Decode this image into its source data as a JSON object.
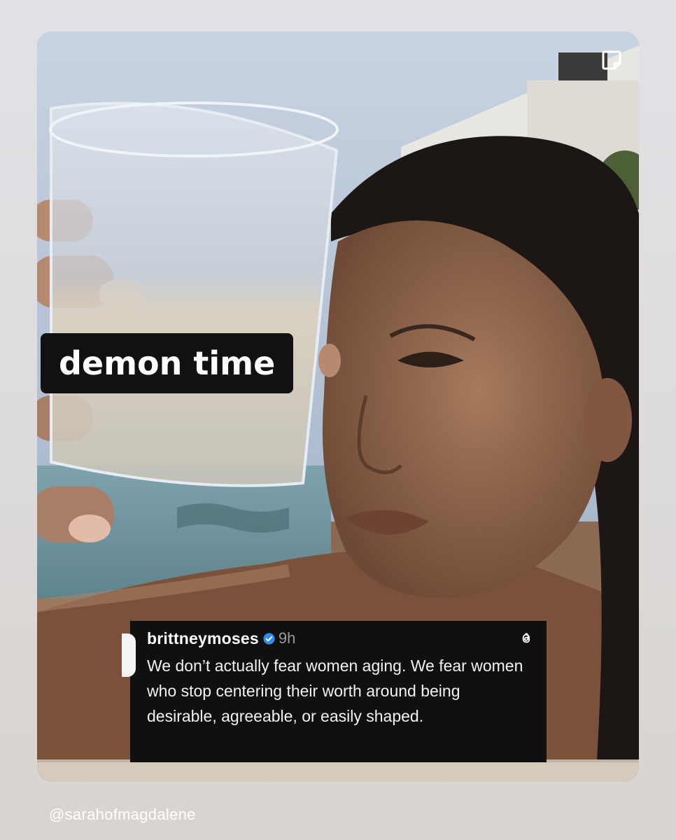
{
  "story": {
    "caption": "demon time",
    "image_subject": "woman-in-pool-holding-glass-selfie"
  },
  "post": {
    "username": "brittneymoses",
    "verified": true,
    "time": "9h",
    "text": "We don’t actually fear women aging. We fear women who stop centering their worth around being desirable, agreeable, or easily shaped.",
    "platform_icon": "threads-icon"
  },
  "footer": {
    "handle": "@sarahofmagdalene"
  },
  "colors": {
    "background": "#dddbdc",
    "caption_bg": "#111111",
    "post_bg": "#101010",
    "verified": "#2f8cf0"
  }
}
